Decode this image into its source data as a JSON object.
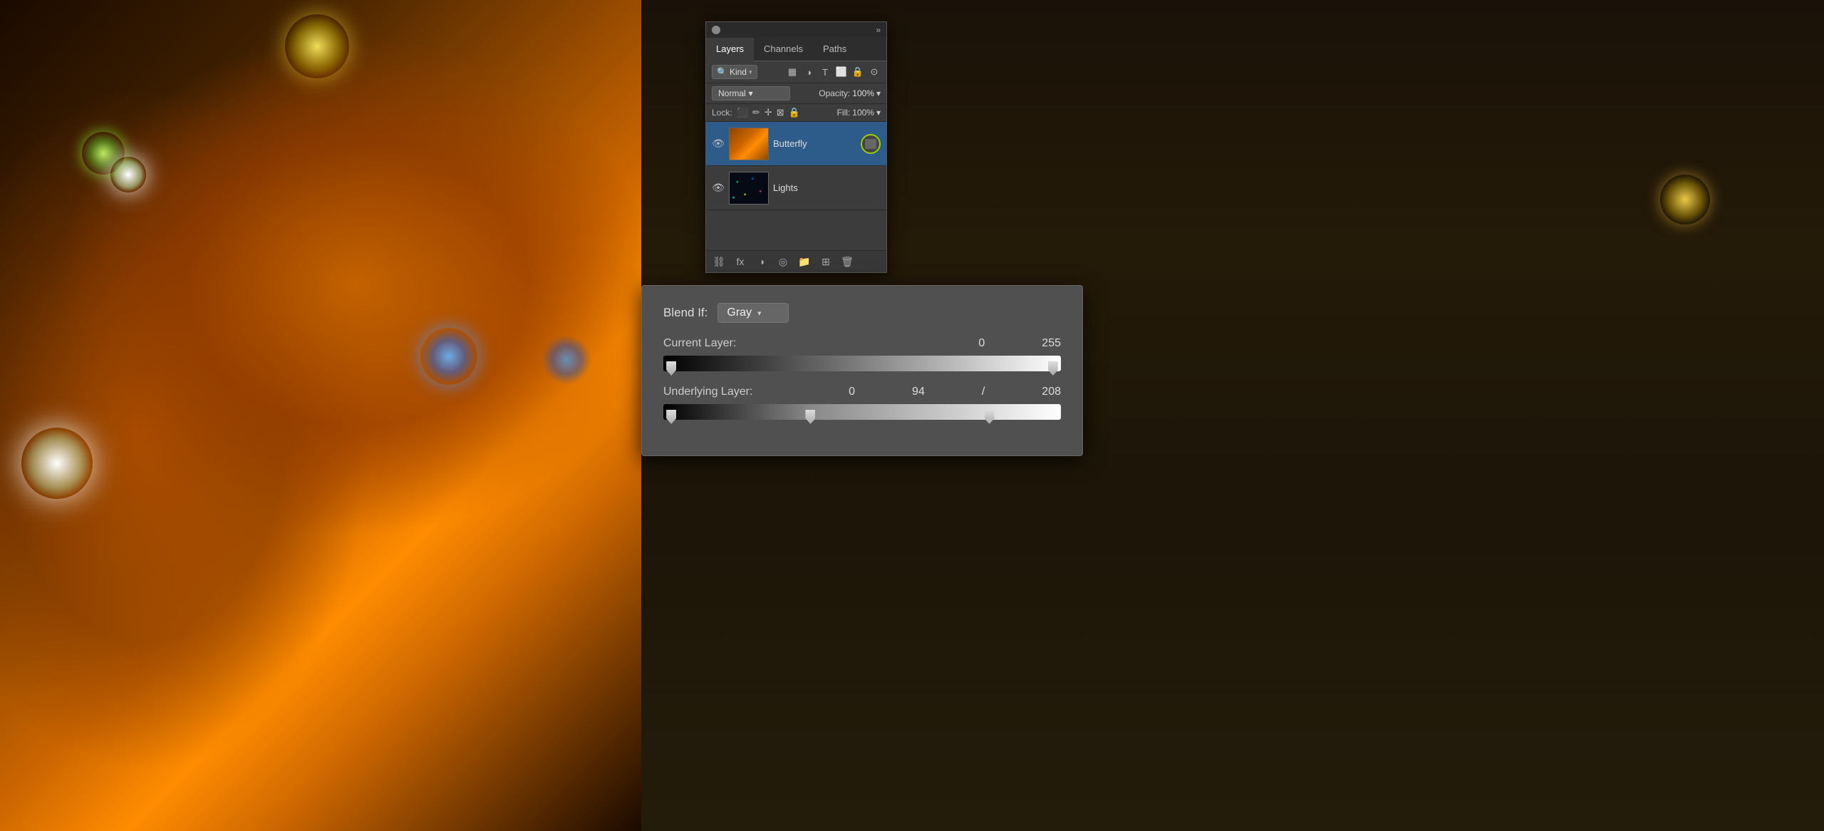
{
  "canvas": {
    "background_desc": "Butterfly photo with lens flares"
  },
  "layers_panel": {
    "title": "Layers Panel",
    "close_label": "×",
    "collapse_label": "»",
    "tabs": [
      {
        "id": "layers",
        "label": "Layers",
        "active": true
      },
      {
        "id": "channels",
        "label": "Channels",
        "active": false
      },
      {
        "id": "paths",
        "label": "Paths",
        "active": false
      }
    ],
    "filter_kind_label": "Kind",
    "toolbar_icons": [
      "pixel-icon",
      "brush-icon",
      "move-icon",
      "link-icon",
      "lock-icon",
      "more-icon"
    ],
    "blend_mode": "Normal",
    "blend_mode_arrow": "▾",
    "opacity_label": "Opacity:",
    "opacity_value": "100%",
    "opacity_arrow": "▾",
    "lock_label": "Lock:",
    "fill_label": "Fill:",
    "fill_value": "100%",
    "fill_arrow": "▾",
    "layers": [
      {
        "id": "butterfly",
        "name": "Butterfly",
        "visible": true,
        "thumb": "butterfly",
        "has_badge": true
      },
      {
        "id": "lights",
        "name": "Lights",
        "visible": true,
        "thumb": "lights",
        "has_badge": false
      }
    ],
    "bottom_icons": [
      "link-icon",
      "fx-icon",
      "circle-half-icon",
      "group-circle-icon",
      "folder-icon",
      "new-layer-icon",
      "trash-icon"
    ]
  },
  "blend_if": {
    "title": "Blend If Panel",
    "blend_if_label": "Blend If:",
    "blend_if_value": "Gray",
    "blend_if_arrow": "▾",
    "current_layer_label": "Current Layer:",
    "current_layer_left": "0",
    "current_layer_right": "255",
    "underlying_layer_label": "Underlying Layer:",
    "underlying_layer_left": "0",
    "underlying_layer_mid": "94",
    "underlying_layer_slash": "/",
    "underlying_layer_right": "208"
  }
}
